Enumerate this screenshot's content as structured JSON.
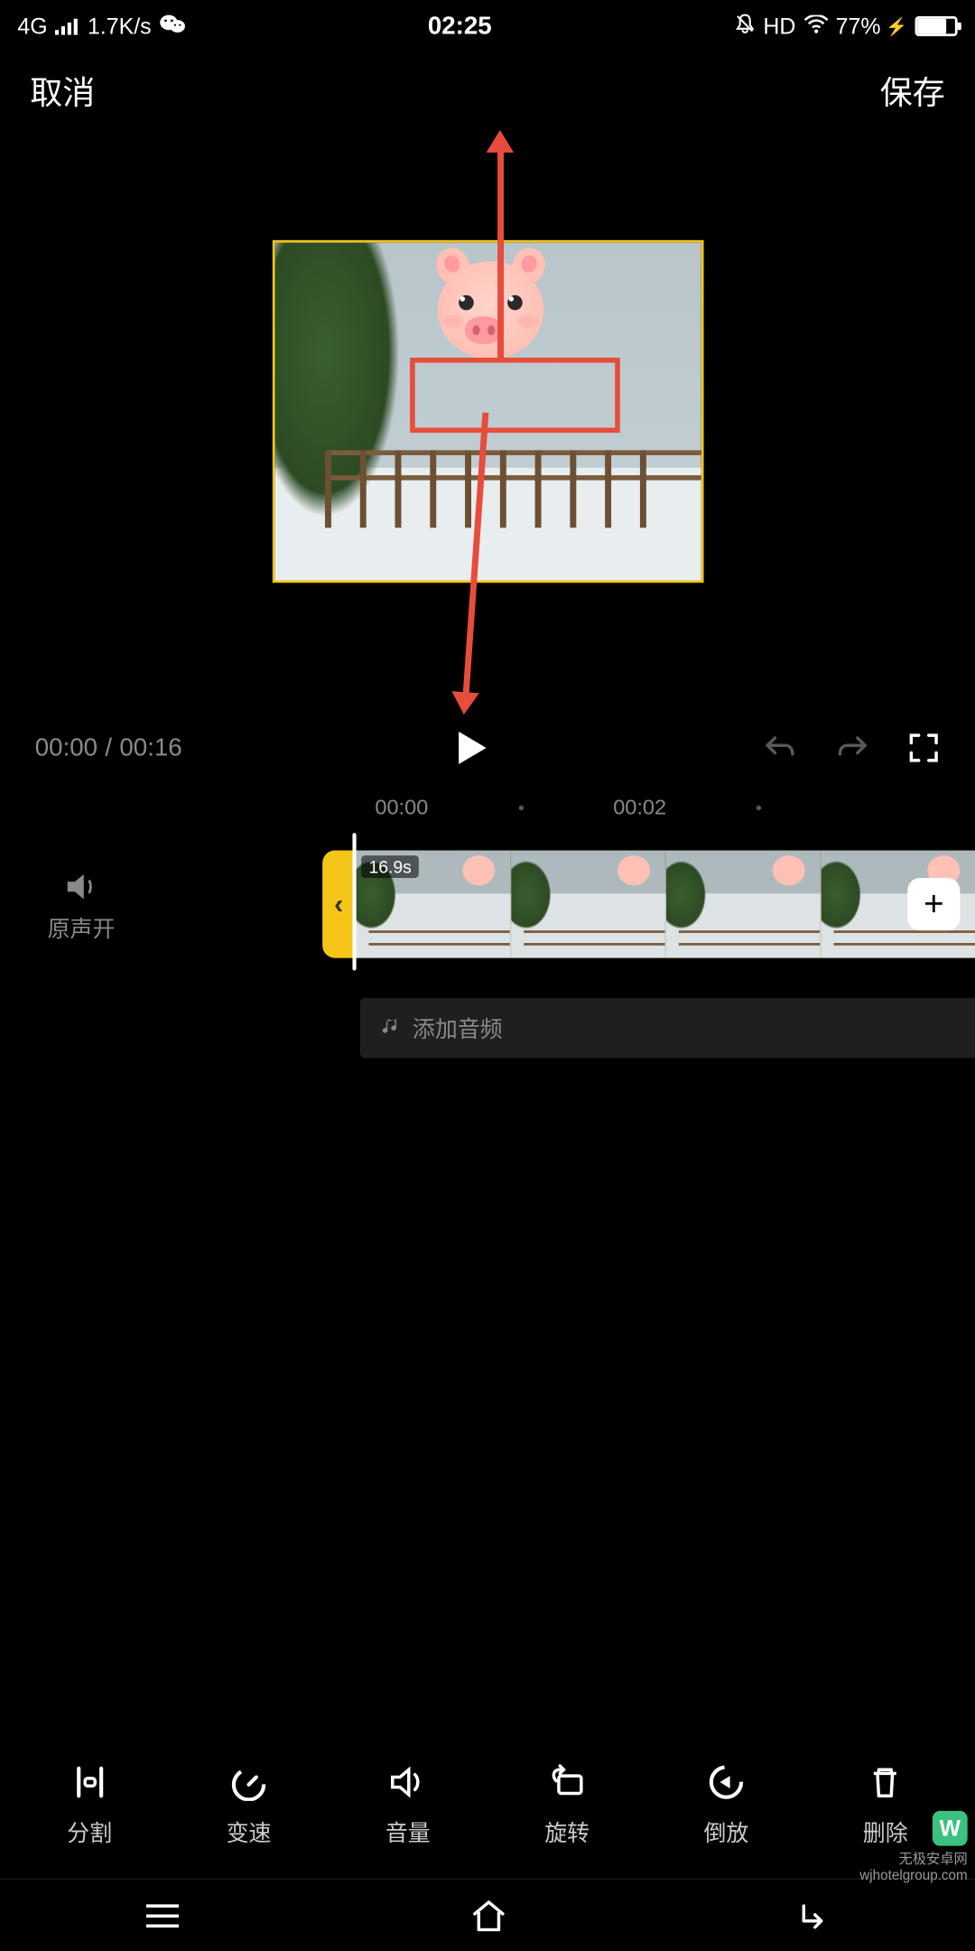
{
  "status": {
    "network": "4G",
    "speed": "1.7K/s",
    "time": "02:25",
    "hd": "HD",
    "battery_pct": "77%"
  },
  "header": {
    "cancel": "取消",
    "save": "保存"
  },
  "playback": {
    "current": "00:00",
    "sep": "/",
    "total": "00:16"
  },
  "ruler": {
    "t0": "00:00",
    "t1": "00:02"
  },
  "timeline": {
    "sound_label": "原声开",
    "clip_duration": "16.9s",
    "handle_arrow": "‹",
    "add_label": "+"
  },
  "audio": {
    "add_label": "添加音频"
  },
  "tools": {
    "split": "分割",
    "speed": "变速",
    "volume": "音量",
    "rotate": "旋转",
    "reverse": "倒放",
    "delete": "删除"
  },
  "watermark": {
    "title": "无极安卓网",
    "url": "wjhotelgroup.com"
  }
}
